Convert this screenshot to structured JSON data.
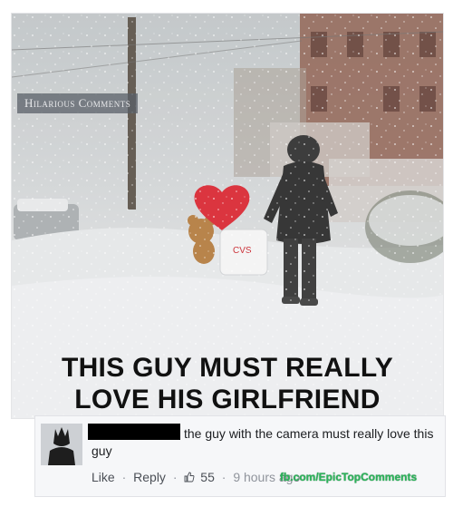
{
  "post": {
    "watermark": "Hilarious Comments",
    "caption_line1": "THIS GUY MUST REALLY",
    "caption_line2": "LOVE HIS GIRLFRIEND"
  },
  "comment": {
    "text": "the guy with the camera must really love this guy",
    "actions": {
      "like": "Like",
      "reply": "Reply",
      "likes_count": "55",
      "time": "9 hours ago"
    },
    "overlay_watermark": "fb.com/EpicTopComments"
  },
  "colors": {
    "accent": "#2bb45a",
    "caption_text": "#111111",
    "link": "#4b4f56"
  },
  "icons": [
    "like-thumb-icon"
  ]
}
